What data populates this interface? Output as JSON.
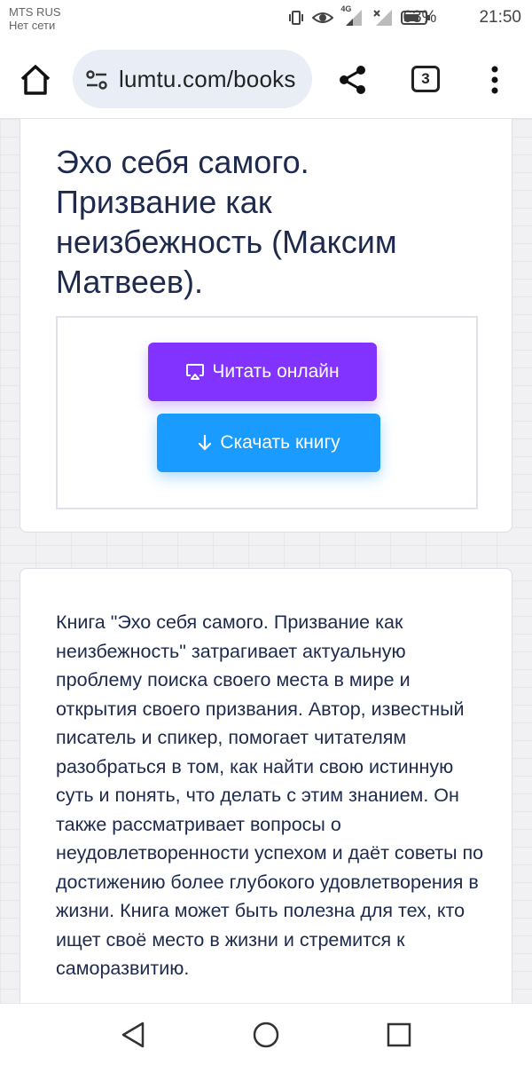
{
  "status_bar": {
    "carrier": "MTS RUS",
    "network": "Нет сети",
    "network_type": "4G",
    "battery": "63%",
    "time": "21:50"
  },
  "browser": {
    "url": "lumtu.com/books",
    "tab_count": "3"
  },
  "book": {
    "title": "Эхо себя самого. Призвание как неизбежность (Максим Матвеев).",
    "read_button": "Читать онлайн",
    "download_button": "Скачать книгу",
    "description": "Книга \"Эхо себя самого. Призвание как неизбежность\" затрагивает актуальную проблему поиска своего места в мире и открытия своего призвания. Автор, известный писатель и спикер, помогает читателям разобраться в том, как найти свою истинную суть и понять, что делать с этим знанием. Он также рассматривает вопросы о неудовлетворенности успехом и даёт советы по достижению более глубокого удовлетворения в жизни. Книга может быть полезна для тех, кто ищет своё место в жизни и стремится к саморазвитию."
  },
  "colors": {
    "read_button": "#8233ff",
    "download_button": "#1a9bff",
    "title_text": "#1d2a4d"
  },
  "icons": {
    "home": "home-icon",
    "site_settings": "tune-icon",
    "share": "share-icon",
    "menu": "more-vert-icon",
    "read": "screen-cast-icon",
    "download": "arrow-down-icon",
    "back": "back-triangle-icon",
    "home_nav": "home-circle-icon",
    "recents": "recents-square-icon"
  }
}
